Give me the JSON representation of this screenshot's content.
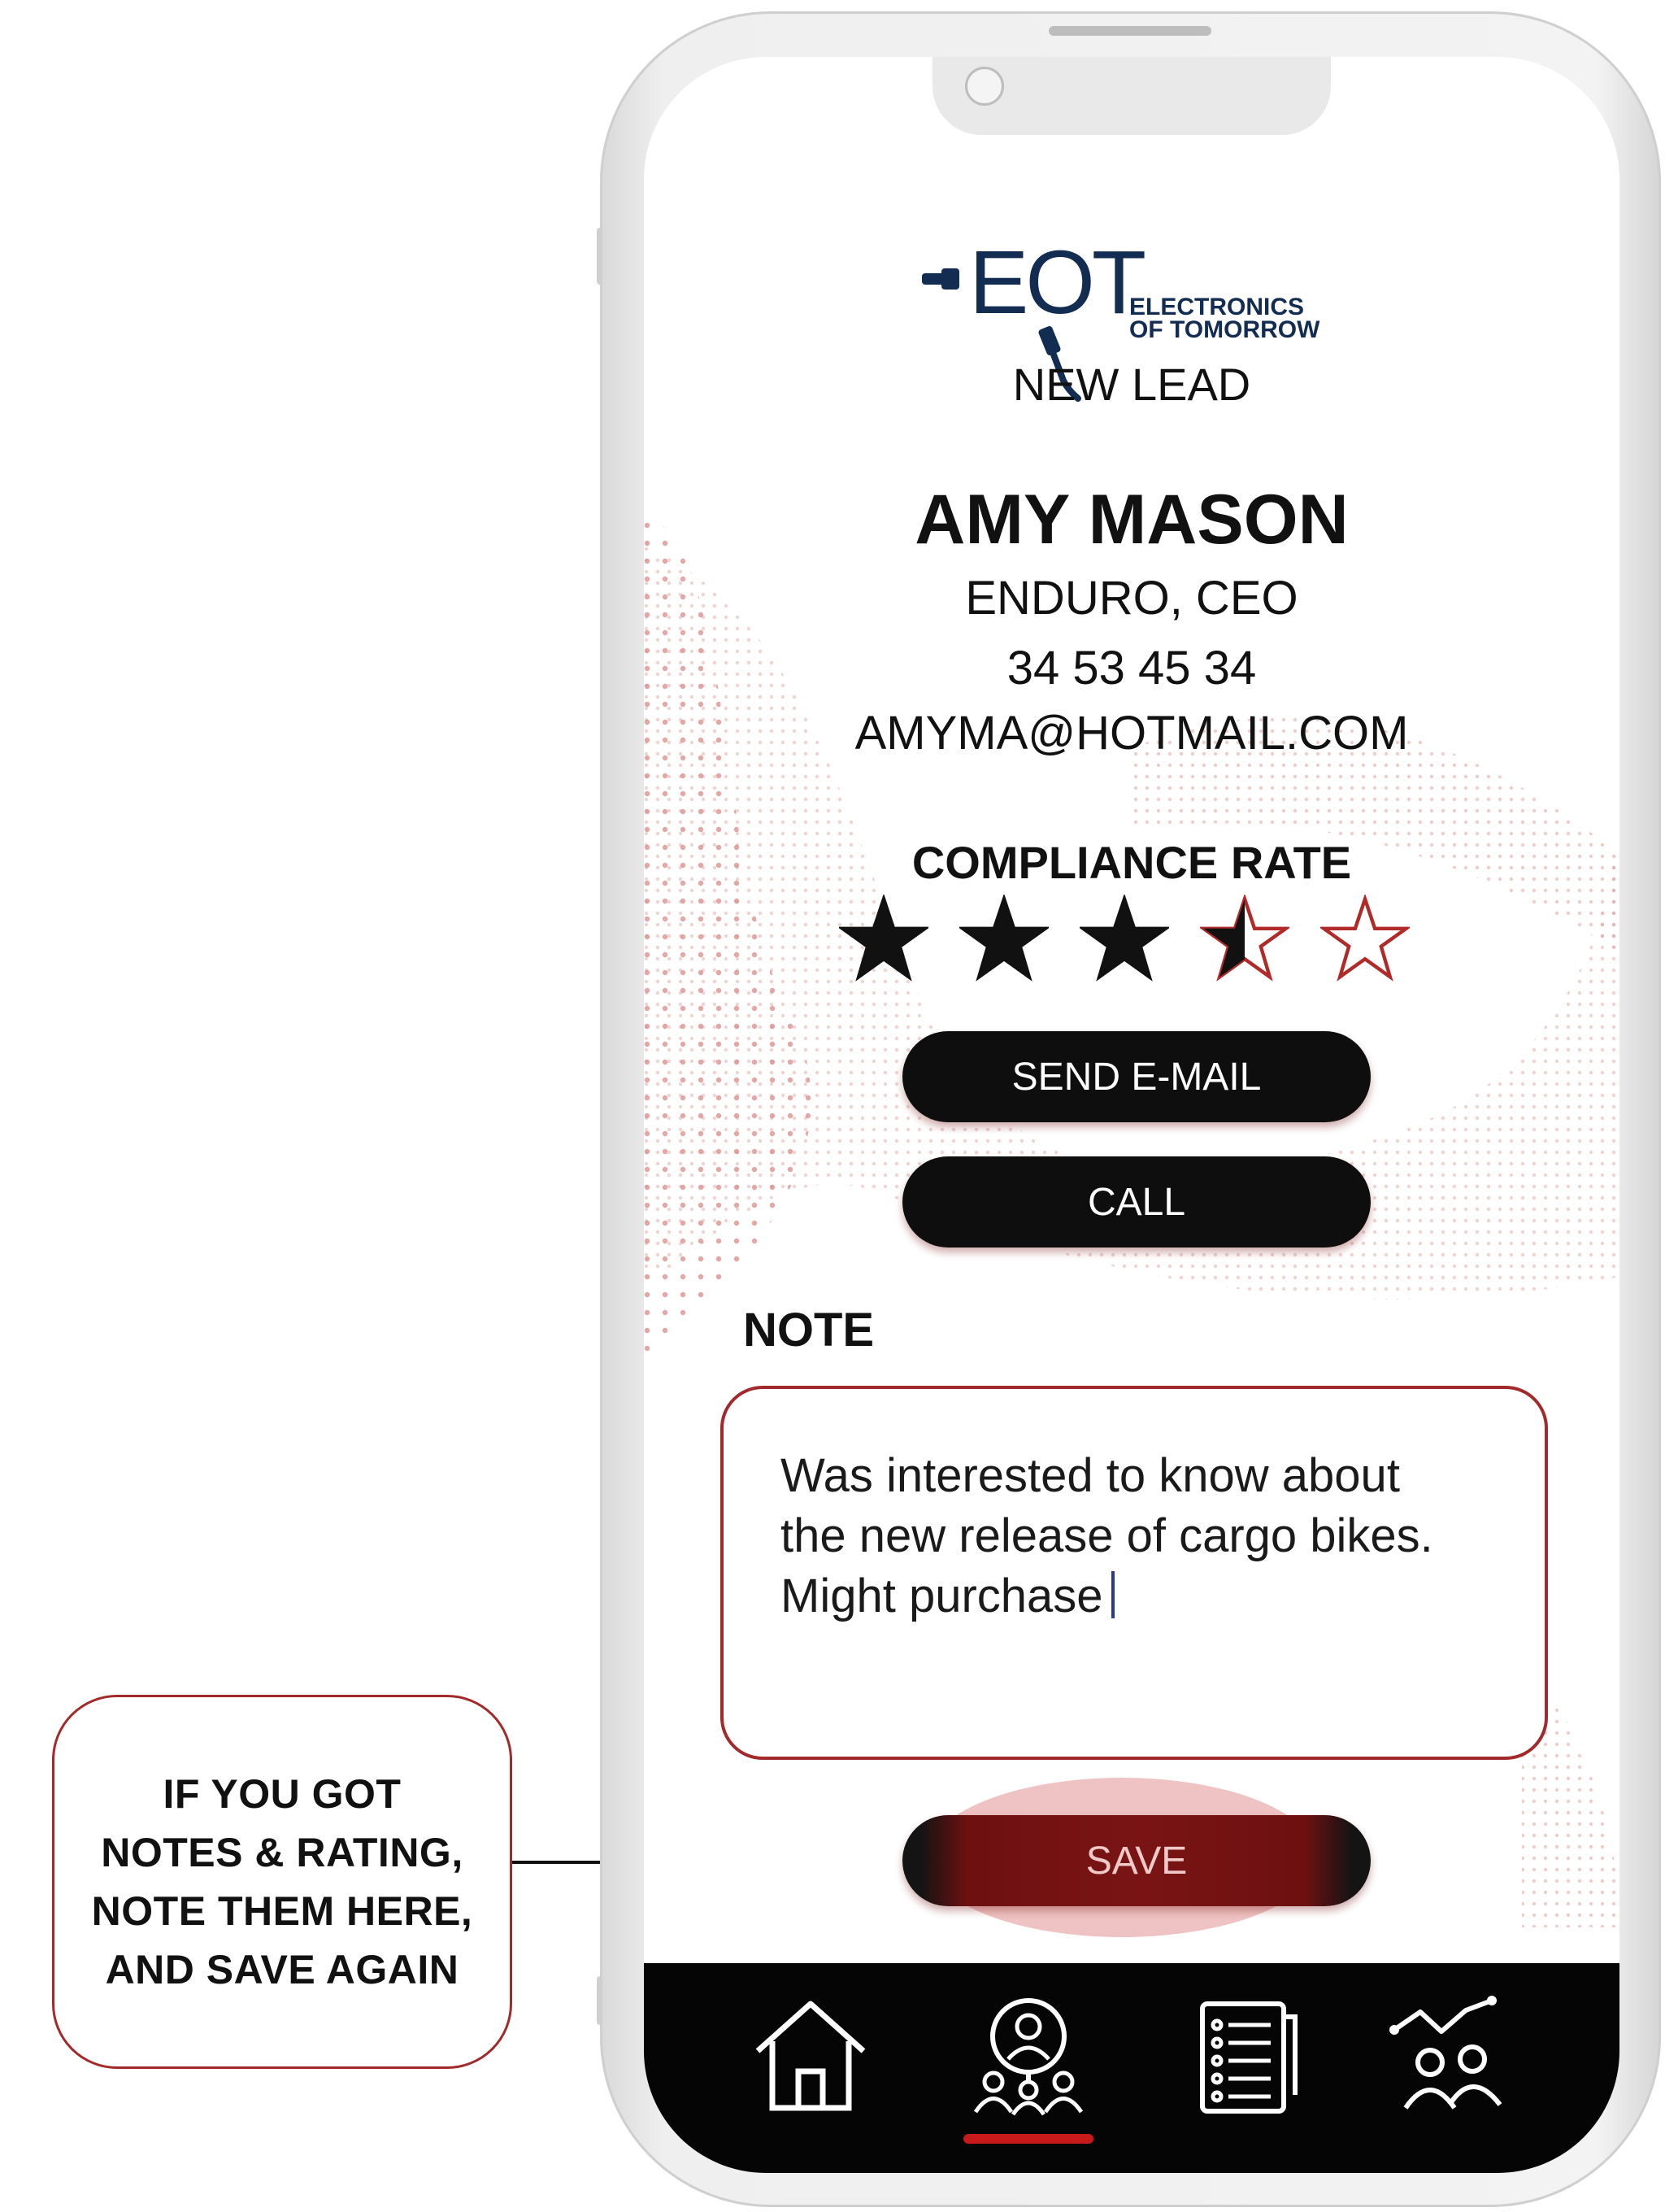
{
  "callout": {
    "lines": [
      "IF YOU GOT",
      "NOTES & RATING,",
      "NOTE THEM HERE,",
      "AND SAVE AGAIN"
    ]
  },
  "logo": {
    "mark": "EOT",
    "tagline_line1": "ELECTRONICS",
    "tagline_line2": "OF TOMORROW",
    "color": "#132c52"
  },
  "screen": {
    "subtitle": "NEW LEAD",
    "lead": {
      "name": "AMY MASON",
      "company": "ENDURO, CEO",
      "phone": "34 53 45 34",
      "email": "AMYMA@HOTMAIL.COM"
    },
    "rating": {
      "label": "COMPLIANCE RATE",
      "value": 3.5,
      "max": 5
    },
    "buttons": {
      "send_email": "SEND E-MAIL",
      "call": "CALL",
      "save": "SAVE"
    },
    "note": {
      "label": "NOTE",
      "value": "Was interested to know about\nthe new release of cargo bikes.\nMight purchase"
    }
  },
  "tabbar": {
    "tabs": [
      {
        "icon": "home-icon",
        "active": false
      },
      {
        "icon": "lead-search-icon",
        "active": true
      },
      {
        "icon": "checklist-icon",
        "active": false
      },
      {
        "icon": "analytics-team-icon",
        "active": false
      }
    ],
    "active_color": "#c81a1a"
  },
  "colors": {
    "accent": "#a32a2a",
    "button_dark": "#0e0e0e",
    "save_button": "#7a1414"
  }
}
